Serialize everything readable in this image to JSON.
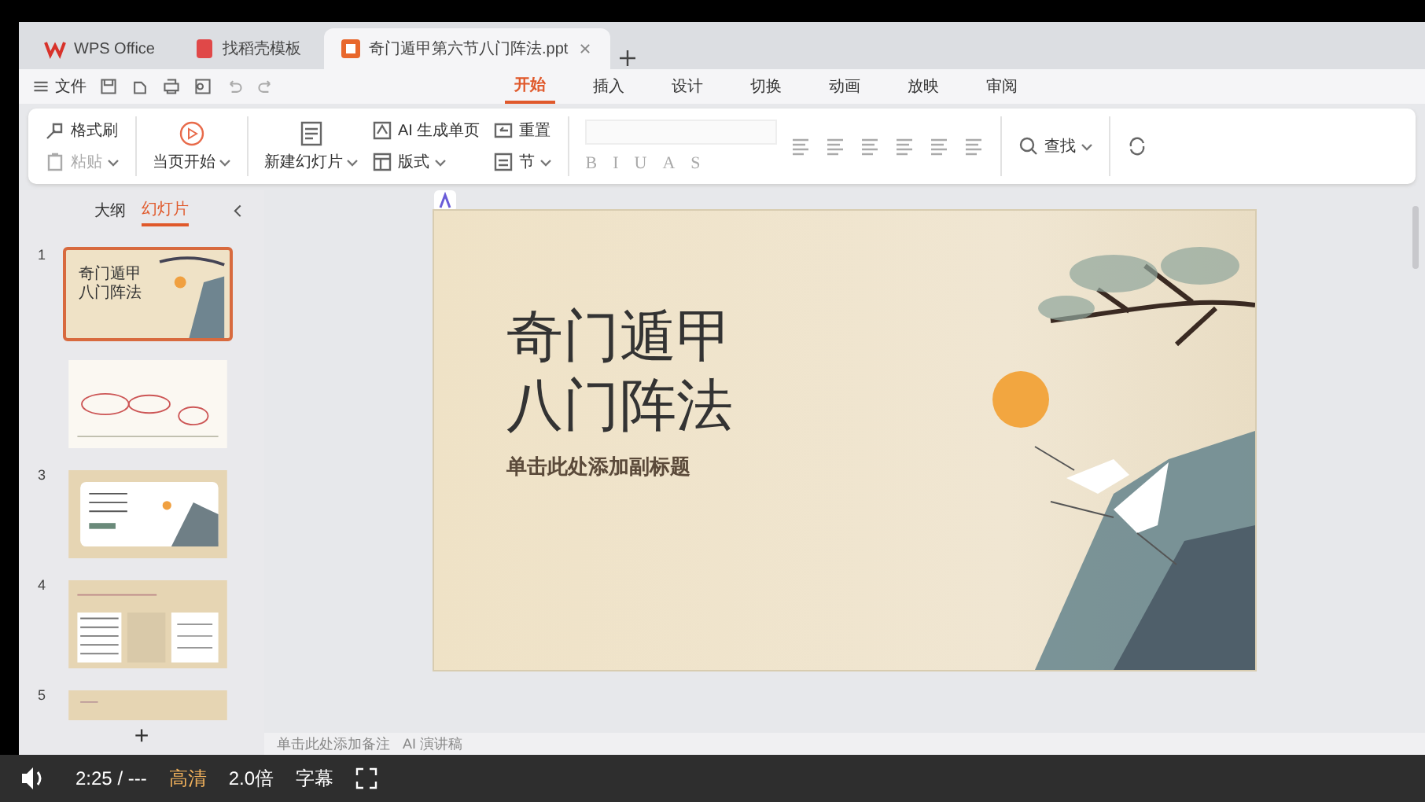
{
  "app_tabs": [
    {
      "label": "WPS Office",
      "kind": "home",
      "selected": false
    },
    {
      "label": "找稻壳模板",
      "kind": "template",
      "selected": false
    },
    {
      "label": "奇门遁甲第六节八门阵法.ppt",
      "kind": "document",
      "selected": true
    }
  ],
  "menu": {
    "file": "文件",
    "ribbon_tabs": [
      {
        "label": "开始",
        "selected": true
      },
      {
        "label": "插入",
        "selected": false
      },
      {
        "label": "设计",
        "selected": false
      },
      {
        "label": "切换",
        "selected": false
      },
      {
        "label": "动画",
        "selected": false
      },
      {
        "label": "放映",
        "selected": false
      },
      {
        "label": "审阅",
        "selected": false
      }
    ]
  },
  "ribbon": {
    "groups": [
      {
        "kind": "buttons",
        "items": [
          {
            "label": "格式刷",
            "kind": "small",
            "dropdown": false,
            "disabled": false
          },
          {
            "label": "粘贴",
            "kind": "small",
            "dropdown": true,
            "disabled": true
          }
        ]
      },
      {
        "kind": "buttons",
        "items": [
          {
            "label": "当页开始",
            "kind": "large",
            "dropdown": true,
            "disabled": false
          }
        ]
      },
      {
        "kind": "buttons",
        "items": [
          {
            "label": "新建幻灯片",
            "kind": "large",
            "dropdown": true,
            "disabled": false
          },
          {
            "label": "AI 生成单页",
            "kind": "small",
            "dropdown": false,
            "disabled": false
          },
          {
            "label": "版式",
            "kind": "small",
            "dropdown": true,
            "disabled": false
          },
          {
            "label": "重置",
            "kind": "small",
            "dropdown": false,
            "disabled": false
          },
          {
            "label": "节",
            "kind": "small",
            "dropdown": true,
            "disabled": false
          }
        ]
      },
      {
        "kind": "format",
        "letters": [
          "B",
          "I",
          "U",
          "A",
          "S"
        ]
      },
      {
        "kind": "buttons",
        "items": [
          {
            "label": "查找",
            "kind": "small",
            "dropdown": true,
            "disabled": false
          }
        ]
      }
    ]
  },
  "sidebar": {
    "tabs": [
      {
        "label": "大纲",
        "selected": false
      },
      {
        "label": "幻灯片",
        "selected": true
      }
    ],
    "slides": [
      {
        "number": "1",
        "kind": "title",
        "selected": true,
        "lines": [
          "奇门遁甲",
          "八门阵法"
        ]
      },
      {
        "kind": "diagram",
        "selected": false
      },
      {
        "number": "3",
        "kind": "list",
        "selected": false
      },
      {
        "number": "4",
        "kind": "table",
        "selected": false
      },
      {
        "number": "5",
        "kind": "plain",
        "selected": false
      }
    ],
    "add": "+"
  },
  "slide": {
    "title_lines": [
      "奇门遁甲",
      "八门阵法"
    ],
    "subtitle": "单击此处添加副标题"
  },
  "notes": {
    "placeholder": "单击此处添加备注",
    "ai_button": "AI 演讲稿"
  },
  "player": {
    "time": "2:25 / ---",
    "quality": "高清",
    "speed": "2.0倍",
    "subtitles": "字幕"
  }
}
